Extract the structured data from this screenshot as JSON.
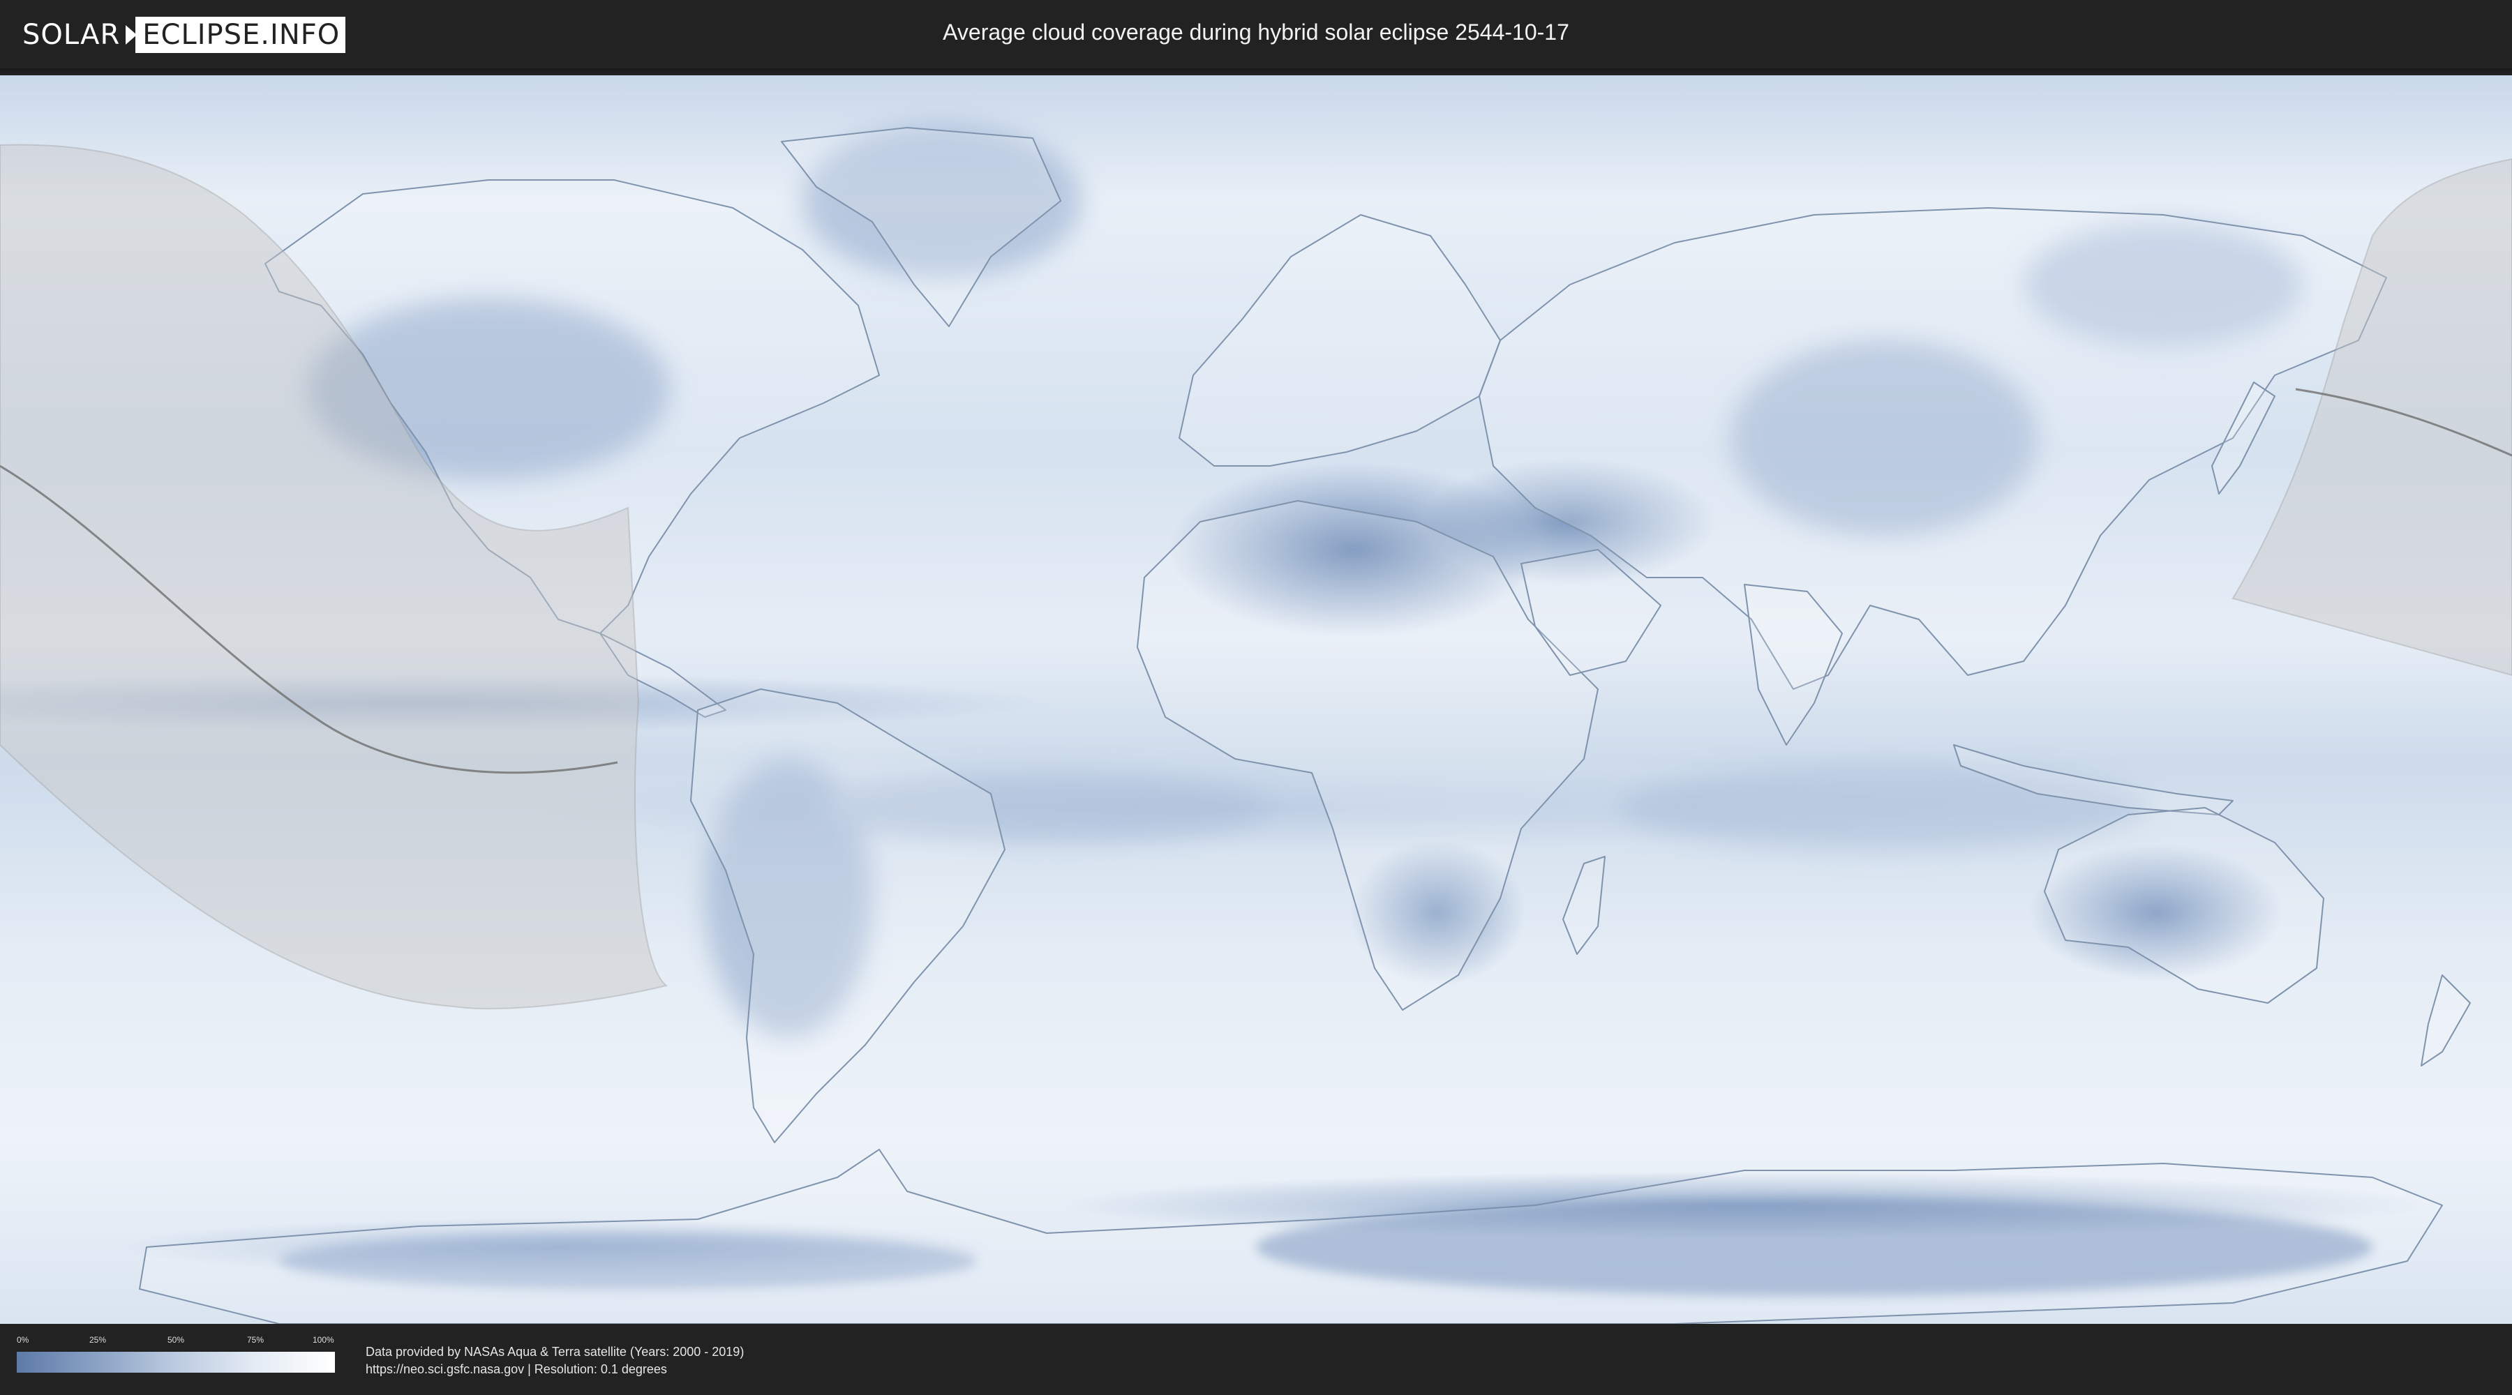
{
  "header": {
    "logo_left": "SOLAR",
    "logo_right": "ECLIPSE.INFO",
    "title": "Average cloud coverage during hybrid solar eclipse 2544-10-17"
  },
  "map": {
    "projection": "equirectangular world map",
    "colors": {
      "ocean_clear": "#eef3f9",
      "cloud_low": "#5d7aa8",
      "eclipse_overlay": "#c8c8c8",
      "eclipse_path": "#6a6a6a",
      "coastline": "#7f93ad"
    }
  },
  "legend": {
    "ticks": [
      "0%",
      "25%",
      "50%",
      "75%",
      "100%"
    ]
  },
  "footer": {
    "credit_line1": "Data provided by NASAs Aqua & Terra satellite (Years: 2000 - 2019)",
    "credit_line2": "https://neo.sci.gsfc.nasa.gov | Resolution: 0.1 degrees"
  }
}
